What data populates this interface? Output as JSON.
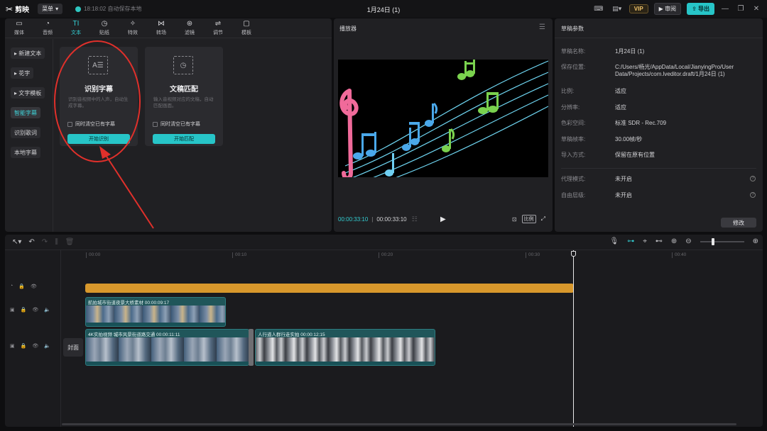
{
  "titlebar": {
    "app_name": "剪映",
    "menu_label": "菜单",
    "save_status": "18:18:02 自动保存本地",
    "doc_title": "1月24日 (1)",
    "vip_label": "VIP",
    "review_label": "审阅",
    "export_label": "导出"
  },
  "toolbar_tabs": [
    {
      "label": "媒体",
      "icon": "media-icon"
    },
    {
      "label": "音频",
      "icon": "audio-icon"
    },
    {
      "label": "文本",
      "icon": "text-icon",
      "active": true
    },
    {
      "label": "贴纸",
      "icon": "sticker-icon"
    },
    {
      "label": "特效",
      "icon": "effects-icon"
    },
    {
      "label": "转场",
      "icon": "transition-icon"
    },
    {
      "label": "滤镜",
      "icon": "filter-icon"
    },
    {
      "label": "调节",
      "icon": "adjust-icon"
    },
    {
      "label": "模板",
      "icon": "template-icon"
    }
  ],
  "text_nav": [
    "新建文本",
    "花字",
    "文字模板",
    "智能字幕",
    "识别歌词",
    "本地字幕"
  ],
  "text_nav_active": "智能字幕",
  "cards": {
    "recognize": {
      "title": "识别字幕",
      "desc": "识别音视频中的人声，自动生成字幕。",
      "checkbox": "同时清空已有字幕",
      "button": "开始识别"
    },
    "match": {
      "title": "文稿匹配",
      "desc": "输入音视频对应的文稿，自动匹配画面。",
      "checkbox": "同时清空已有字幕",
      "button": "开始匹配"
    }
  },
  "player": {
    "title": "播放器",
    "current_time": "00:00:33:10",
    "total_time": "00:00:33:10",
    "ratio_label": "比例"
  },
  "params": {
    "title": "草稿参数",
    "rows": [
      {
        "key": "草稿名称:",
        "value": "1月24日 (1)"
      },
      {
        "key": "保存位置:",
        "value": "C:/Users/杨光/AppData/Local/JianyingPro/User Data/Projects/com.lveditor.draft/1月24日 (1)"
      },
      {
        "key": "比例:",
        "value": "适应"
      },
      {
        "key": "分辨率:",
        "value": "适应"
      },
      {
        "key": "色彩空间:",
        "value": "标准 SDR - Rec.709"
      },
      {
        "key": "草稿帧率:",
        "value": "30.00帧/秒"
      },
      {
        "key": "导入方式:",
        "value": "保留在原有位置"
      },
      {
        "key": "代理模式:",
        "value": "未开启"
      },
      {
        "key": "自由层级:",
        "value": "未开启"
      }
    ],
    "modify_label": "修改"
  },
  "timeline": {
    "ruler_ticks": [
      "00:00",
      "00:10",
      "00:20",
      "00:30",
      "00:40"
    ],
    "cover_label": "封面",
    "clips": [
      {
        "label": "航拍城市街道夜景大桥素材  00:00:09:17"
      },
      {
        "label": "4K实拍视频 城市风景街道路交通  00:00:11:11"
      },
      {
        "label": "人行道人群行走实拍  00:00:12:15"
      }
    ]
  },
  "colors": {
    "accent": "#27c5c8",
    "audio_track": "#d8982c",
    "annotation": "#e0302b"
  }
}
